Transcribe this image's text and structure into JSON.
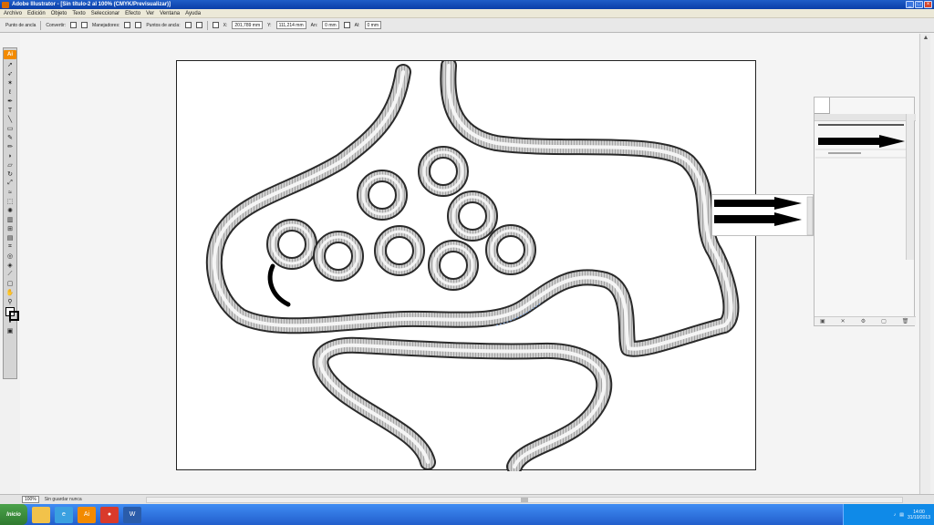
{
  "window": {
    "title": "Adobe Illustrator - [Sin título-2 al 100% (CMYK/Previsualizar)]",
    "controls": [
      "_",
      "□",
      "×"
    ]
  },
  "menu": [
    "Archivo",
    "Edición",
    "Objeto",
    "Texto",
    "Seleccionar",
    "Efecto",
    "Ver",
    "Ventana",
    "Ayuda"
  ],
  "controlbar": {
    "anchor_label": "Punto de ancla",
    "convert_label": "Convertir:",
    "handles_label": "Manejadores:",
    "anchors_label": "Puntos de ancla:",
    "x_value": "201,789 mm",
    "y_value": "111,214 mm",
    "w_value": "0 mm",
    "h_value": "0 mm"
  },
  "toolbox": {
    "logo": "Ai",
    "tools": [
      "selection-tool",
      "direct-selection-tool",
      "magic-wand-tool",
      "lasso-tool",
      "pen-tool",
      "type-tool",
      "line-tool",
      "rectangle-tool",
      "paintbrush-tool",
      "pencil-tool",
      "blob-brush-tool",
      "eraser-tool",
      "rotate-tool",
      "scale-tool",
      "warp-tool",
      "free-transform-tool",
      "symbol-sprayer-tool",
      "graph-tool",
      "mesh-tool",
      "gradient-tool",
      "eyedropper-tool",
      "blend-tool",
      "live-paint-tool",
      "slice-tool",
      "artboard-tool",
      "hand-tool",
      "zoom-tool"
    ]
  },
  "statusbar": {
    "zoom": "100%",
    "message": "Sin guardar nunca"
  },
  "taskbar": {
    "start_label": "Inicio",
    "clock_time": "14:00",
    "clock_date": "31/10/2013"
  },
  "colors": {
    "artboard": "#ffffff",
    "stroke_dark": "#333333",
    "stroke_light": "#d8d8d8",
    "logo": "#f28a00"
  }
}
